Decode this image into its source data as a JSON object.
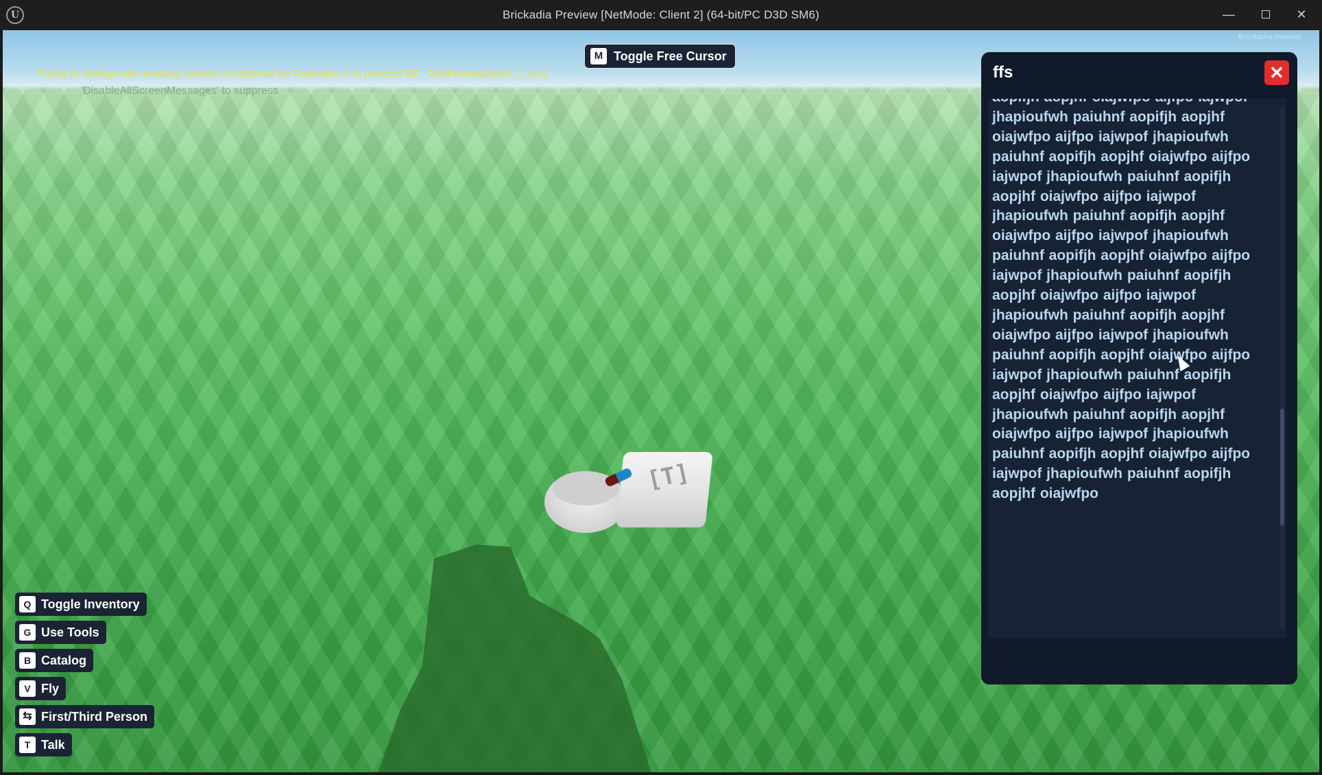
{
  "window": {
    "title": "Brickadia Preview [NetMode: Client 2]  (64-bit/PC D3D SM6)",
    "logo": "U",
    "min_icon": "—",
    "close_icon": "✕"
  },
  "viewport": {
    "watermark": "Brickadia Internal",
    "debug_message": "Trying to change non-existing custom conditional for RepIndex 5 in protocol BP_ToolPreviewActor_C (x2)",
    "debug_hint": "'DisableAllScreenMessages' to suppress",
    "prop_label": "[T]"
  },
  "cursor_toggle": {
    "key": "M",
    "label": "Toggle Free Cursor"
  },
  "hints": [
    {
      "key": "Q",
      "label": "Toggle Inventory"
    },
    {
      "key": "G",
      "label": "Use Tools"
    },
    {
      "key": "B",
      "label": "Catalog"
    },
    {
      "key": "V",
      "label": "Fly"
    },
    {
      "key": "⇆",
      "label": "First/Third Person"
    },
    {
      "key": "T",
      "label": "Talk"
    }
  ],
  "panel": {
    "title": "ffs",
    "close_icon": "✕",
    "text": "aopifjh aopjhf oiajwfpo aijfpo iajwpof jhapioufwh paiuhnf aopifjh aopjhf oiajwfpo aijfpo iajwpof jhapioufwh paiuhnf aopifjh aopjhf oiajwfpo aijfpo iajwpof jhapioufwh paiuhnf aopifjh aopjhf oiajwfpo aijfpo iajwpof jhapioufwh paiuhnf aopifjh aopjhf oiajwfpo aijfpo iajwpof jhapioufwh paiuhnf aopifjh aopjhf oiajwfpo aijfpo iajwpof jhapioufwh paiuhnf aopifjh aopjhf oiajwfpo aijfpo iajwpof jhapioufwh paiuhnf aopifjh aopjhf oiajwfpo aijfpo iajwpof jhapioufwh paiuhnf aopifjh aopjhf oiajwfpo aijfpo iajwpof jhapioufwh paiuhnf aopifjh aopjhf oiajwfpo aijfpo iajwpof jhapioufwh paiuhnf aopifjh aopjhf oiajwfpo aijfpo iajwpof jhapioufwh paiuhnf aopifjh aopjhf oiajwfpo aijfpo iajwpof jhapioufwh paiuhnf aopifjh aopjhf oiajwfpo"
  }
}
